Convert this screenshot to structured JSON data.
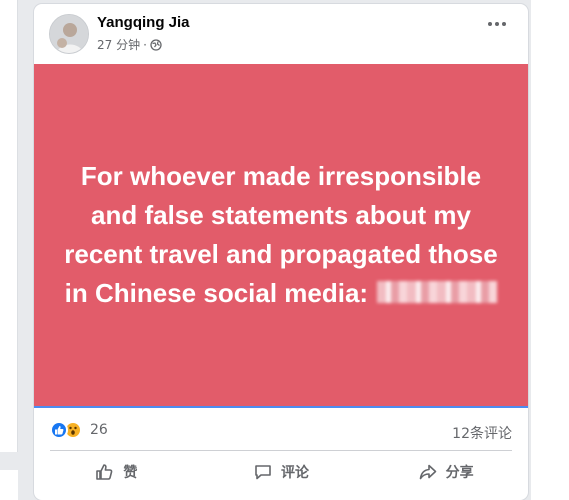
{
  "post": {
    "author": "Yangqing Jia",
    "time": "27 分钟",
    "separator": "·",
    "privacy_icon": "globe-icon",
    "more_icon": "more-options-icon",
    "banner_color": "#e25c6a",
    "banner_text": "For whoever made irresponsible and false statements about my recent travel and propagated those in Chinese social media:"
  },
  "stats": {
    "reactions": [
      "like-reaction-icon",
      "wow-reaction-icon"
    ],
    "reaction_count": "26",
    "comment_count": "12条评论"
  },
  "actions": {
    "like_label": "赞",
    "comment_label": "评论",
    "share_label": "分享"
  }
}
